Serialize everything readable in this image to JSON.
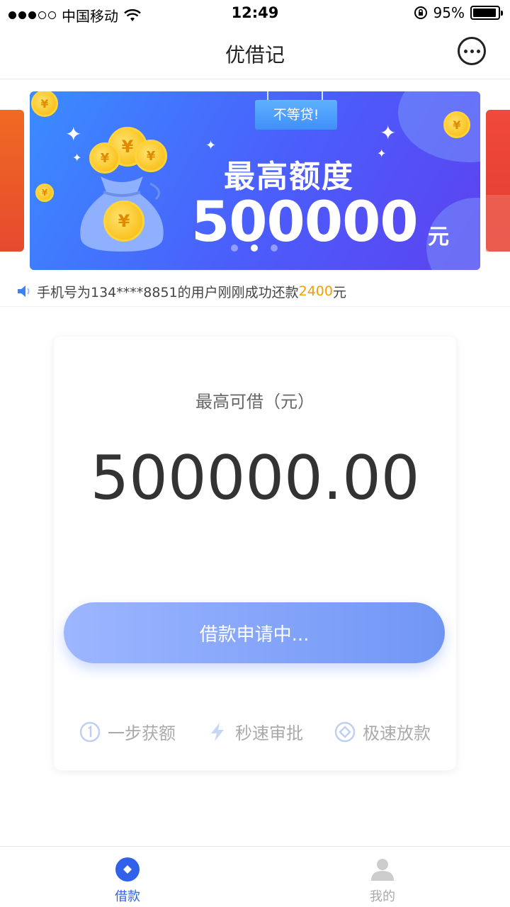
{
  "status_bar": {
    "carrier": "中国移动",
    "time": "12:49",
    "battery_percent": "95%",
    "battery_level": 0.95,
    "signal_bars_filled": 3,
    "signal_bars_total": 5
  },
  "nav": {
    "title": "优借记",
    "more_icon": "more-dots-icon"
  },
  "banner": {
    "tag": "不等贷!",
    "headline": "最高额度",
    "amount": "500000",
    "unit": "元",
    "coin_symbol": "¥",
    "slide_count": 3,
    "active_slide": 1
  },
  "notice": {
    "icon": "speaker-icon",
    "text_prefix": "手机号为134****8851的用户刚刚成功还款",
    "amount": "2400",
    "text_suffix": "元"
  },
  "loan_card": {
    "label": "最高可借（元）",
    "amount": "500000.00",
    "apply_button": "借款申请中...",
    "features": [
      {
        "icon": "number-one-icon",
        "label": "一步获额"
      },
      {
        "icon": "lightning-icon",
        "label": "秒速审批"
      },
      {
        "icon": "coin-icon",
        "label": "极速放款"
      }
    ]
  },
  "tabs": [
    {
      "icon": "loan-icon",
      "label": "借款",
      "active": true
    },
    {
      "icon": "user-icon",
      "label": "我的",
      "active": false
    }
  ],
  "colors": {
    "accent": "#3061e8",
    "notice_amount": "#f0a000",
    "button_start": "#9db6ff",
    "button_end": "#7096f5"
  }
}
